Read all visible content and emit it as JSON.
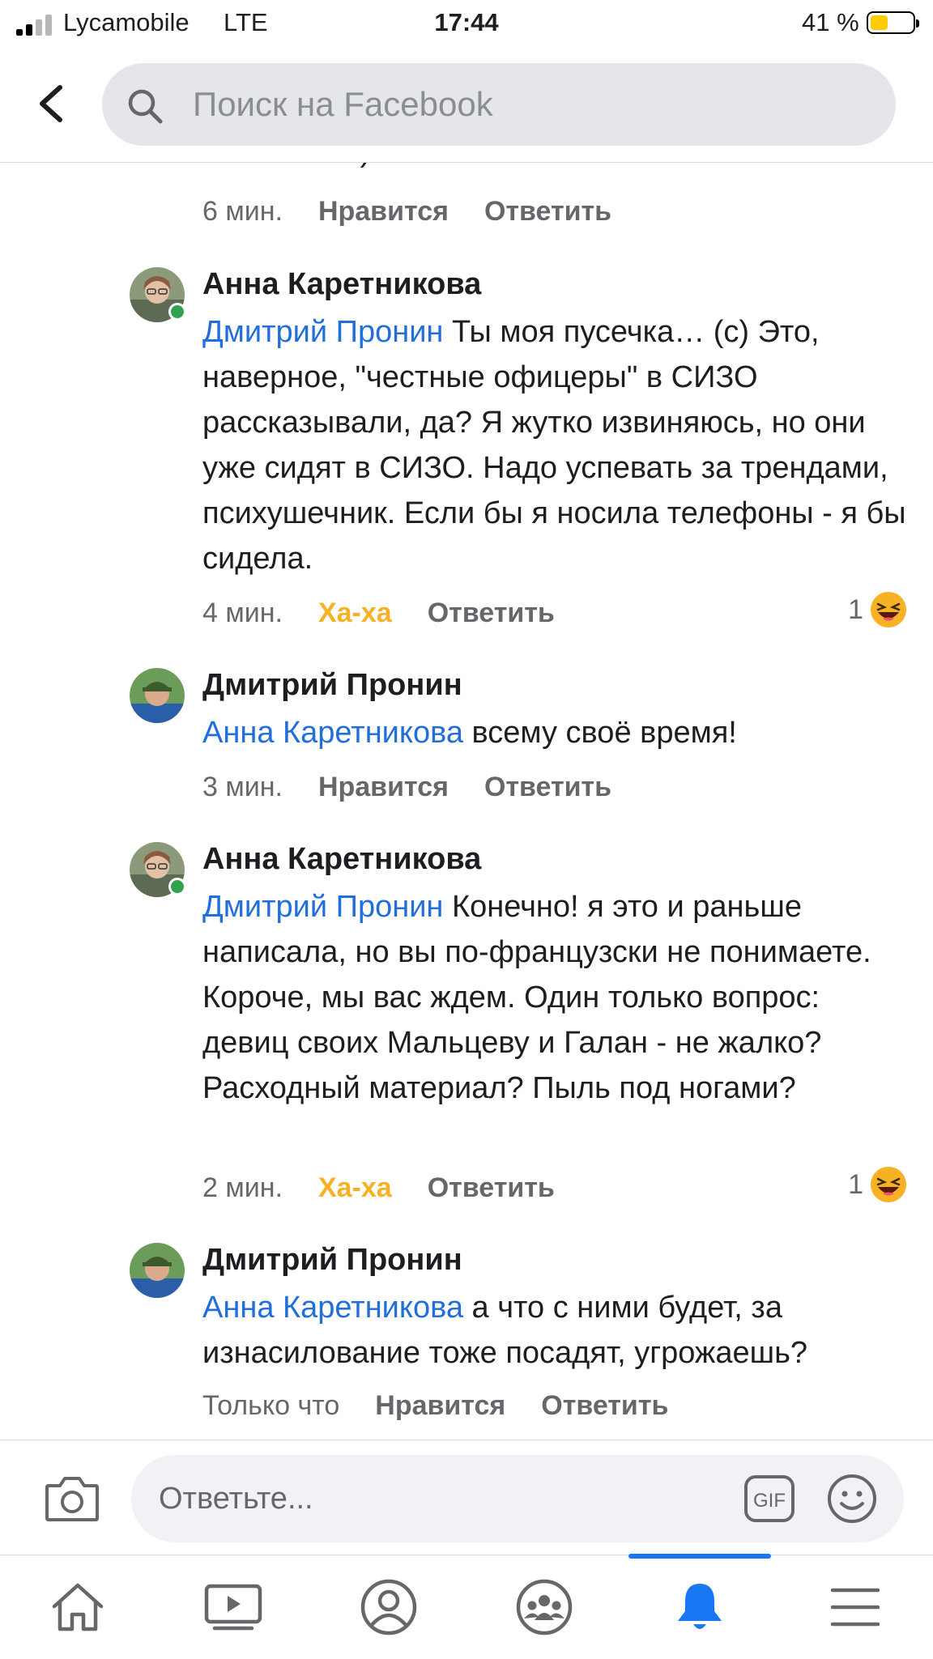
{
  "status_bar": {
    "carrier": "Lycamobile",
    "network": "LTE",
    "time": "17:44",
    "battery_percent": "41 %",
    "battery_level": 0.41
  },
  "header": {
    "search_placeholder": "Поиск на Facebook"
  },
  "partial_comment": {
    "text_fragment": "немножко :)",
    "time": "6 мин.",
    "like_label": "Нравится",
    "reply_label": "Ответить"
  },
  "comments": [
    {
      "author": "Анна Каретникова",
      "mention": "Дмитрий Пронин",
      "text": " Ты моя пусечка… (с) Это, наверное, \"честные офицеры\" в СИЗО рассказывали, да? Я жутко извиняюсь, но они уже сидят в СИЗО. Надо успевать за трендами, психушечник. Если бы я носила телефоны - я бы сидела.",
      "time": "4 мин.",
      "reaction_label": "Ха-ха",
      "reply_label": "Ответить",
      "reaction_count": "1"
    },
    {
      "author": "Дмитрий Пронин",
      "mention": "Анна Каретникова",
      "text": " всему своё время!",
      "time": "3 мин.",
      "like_label": "Нравится",
      "reply_label": "Ответить"
    },
    {
      "author": "Анна Каретникова",
      "mention": "Дмитрий Пронин",
      "text": " Конечно! я это и раньше написала, но вы по-французски не понимаете. Короче, мы вас ждем. Один только вопрос: девиц своих Мальцеву и Галан - не жалко? Расходный материал? Пыль под ногами?",
      "time": "2 мин.",
      "reaction_label": "Ха-ха",
      "reply_label": "Ответить",
      "reaction_count": "1"
    },
    {
      "author": "Дмитрий Пронин",
      "mention": "Анна Каретникова",
      "text": " а что с ними будет, за изнасилование тоже посадят, угрожаешь?",
      "time": "Только что",
      "like_label": "Нравится",
      "reply_label": "Ответить"
    }
  ],
  "reply_bar": {
    "placeholder": "Ответьте...",
    "gif_label": "GIF"
  },
  "tab_bar": {
    "tabs": [
      "home-icon",
      "video-icon",
      "profile-icon",
      "groups-icon",
      "notifications-icon",
      "menu-icon"
    ],
    "active_tab": "notifications-icon"
  },
  "colors": {
    "mention": "#216fdb",
    "haha": "#f7b125",
    "active_tab": "#1877f2",
    "online": "#31a24c"
  }
}
